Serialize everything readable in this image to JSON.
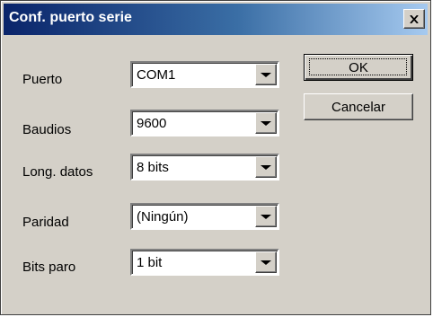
{
  "window": {
    "title": "Conf. puerto serie",
    "close_icon": "close-icon"
  },
  "fields": [
    {
      "label": "Puerto",
      "value": "COM1"
    },
    {
      "label": "Baudios",
      "value": "9600"
    },
    {
      "label": "Long. datos",
      "value": "8 bits"
    },
    {
      "label": "Paridad",
      "value": "(Ningún)"
    },
    {
      "label": "Bits paro",
      "value": "1 bit"
    }
  ],
  "buttons": {
    "ok": "OK",
    "cancel": "Cancelar"
  }
}
